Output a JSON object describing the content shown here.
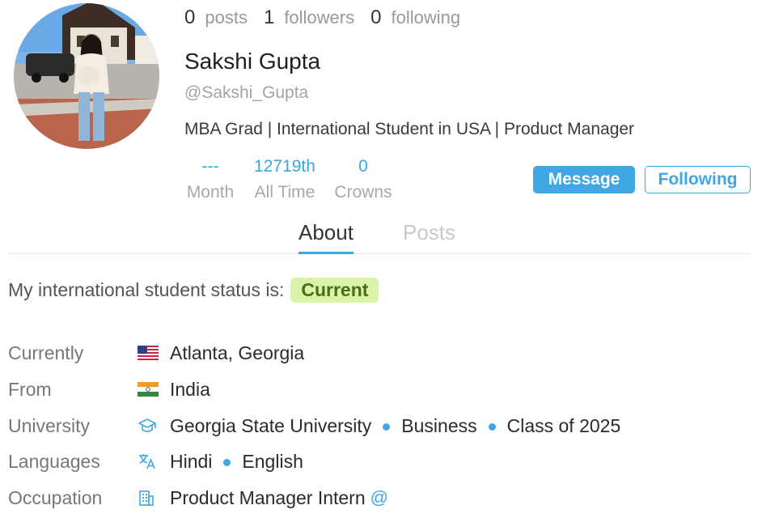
{
  "profile": {
    "name": "Sakshi Gupta",
    "handle": "@Sakshi_Gupta",
    "bio": "MBA Grad | International Student in USA | Product Manager"
  },
  "stats": [
    {
      "value": "0",
      "label": "posts"
    },
    {
      "value": "1",
      "label": "followers"
    },
    {
      "value": "0",
      "label": "following"
    }
  ],
  "ranks": {
    "month": {
      "value": "---",
      "label": "Month"
    },
    "all_time": {
      "value": "12719th",
      "label": "All Time"
    },
    "crowns": {
      "value": "0",
      "label": "Crowns"
    }
  },
  "actions": {
    "message": "Message",
    "following": "Following"
  },
  "tabs": {
    "about": "About",
    "posts": "Posts"
  },
  "status": {
    "text": "My international student status is:",
    "badge": "Current"
  },
  "info": {
    "currently": {
      "label": "Currently",
      "value": "Atlanta, Georgia",
      "icon": "us-flag-icon"
    },
    "from": {
      "label": "From",
      "value": "India",
      "icon": "india-flag-icon"
    },
    "university": {
      "label": "University",
      "school": "Georgia State University",
      "field": "Business",
      "class": "Class of 2025",
      "icon": "graduation-cap-icon"
    },
    "languages": {
      "label": "Languages",
      "items": [
        "Hindi",
        "English"
      ],
      "icon": "translate-icon"
    },
    "occupation": {
      "label": "Occupation",
      "value": "Product Manager Intern",
      "icon": "building-icon",
      "link_icon": "@"
    }
  },
  "colors": {
    "accent": "#3ea7e4",
    "status_badge_bg": "#d9f3a8",
    "status_badge_text": "#4b6a1f"
  }
}
